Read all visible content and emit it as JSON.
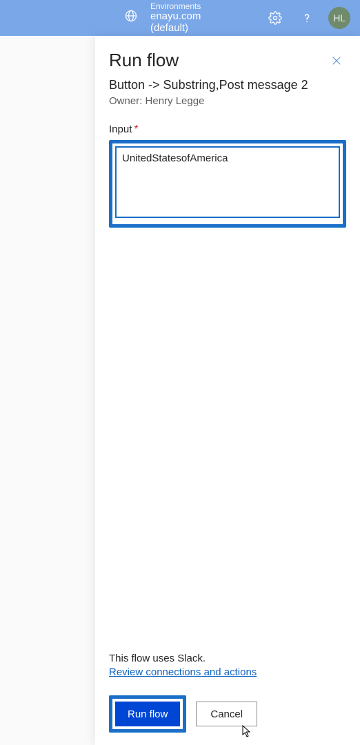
{
  "header": {
    "env_label": "Environments",
    "env_name": "enayu.com (default)",
    "avatar_initials": "HL"
  },
  "panel": {
    "title": "Run flow",
    "flow_name": "Button -> Substring,Post message 2",
    "owner_prefix": "Owner: ",
    "owner_name": "Henry Legge",
    "input_label": "Input",
    "input_value": "UnitedStatesofAmerica",
    "footer_text": "This flow uses Slack.",
    "review_link": "Review connections and actions",
    "run_button": "Run flow",
    "cancel_button": "Cancel"
  }
}
